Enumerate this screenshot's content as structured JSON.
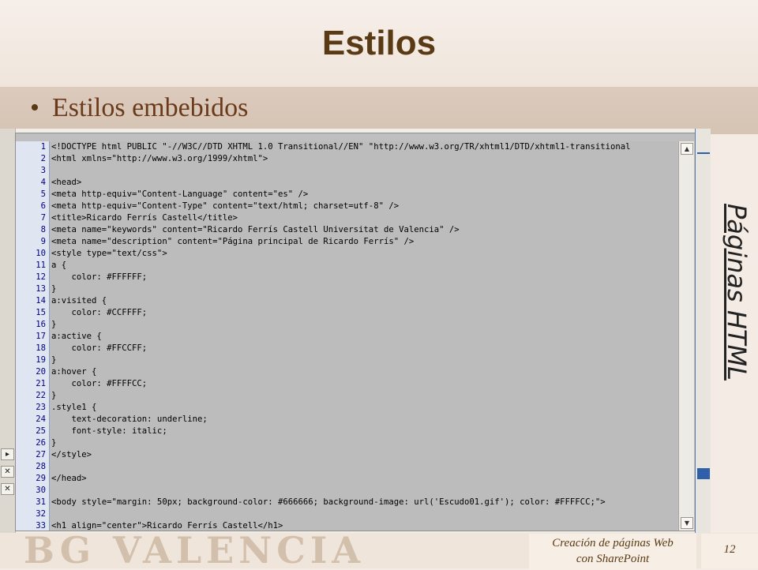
{
  "slide": {
    "title": "Estilos",
    "bullet": "Estilos embebidos",
    "side_title": "Páginas HTML",
    "footer_line1": "Creación de páginas Web",
    "footer_line2": "con SharePoint",
    "page_number": "12",
    "footer_logo_text": "BG VALENCIA"
  },
  "editor": {
    "line_numbers": [
      "1",
      "2",
      "3",
      "4",
      "5",
      "6",
      "7",
      "8",
      "9",
      "10",
      "11",
      "12",
      "13",
      "14",
      "15",
      "16",
      "17",
      "18",
      "19",
      "20",
      "21",
      "22",
      "23",
      "24",
      "25",
      "26",
      "27",
      "28",
      "29",
      "30",
      "31",
      "32",
      "33"
    ],
    "lines": [
      "<!DOCTYPE html PUBLIC \"-//W3C//DTD XHTML 1.0 Transitional//EN\" \"http://www.w3.org/TR/xhtml1/DTD/xhtml1-transitional",
      "<html xmlns=\"http://www.w3.org/1999/xhtml\">",
      "",
      "<head>",
      "<meta http-equiv=\"Content-Language\" content=\"es\" />",
      "<meta http-equiv=\"Content-Type\" content=\"text/html; charset=utf-8\" />",
      "<title>Ricardo Ferrís Castell</title>",
      "<meta name=\"keywords\" content=\"Ricardo Ferrís Castell Universitat de Valencia\" />",
      "<meta name=\"description\" content=\"Página principal de Ricardo Ferrís\" />",
      "<style type=\"text/css\">",
      "a {",
      "    color: #FFFFFF;",
      "}",
      "a:visited {",
      "    color: #CCFFFF;",
      "}",
      "a:active {",
      "    color: #FFCCFF;",
      "}",
      "a:hover {",
      "    color: #FFFFCC;",
      "}",
      ".style1 {",
      "    text-decoration: underline;",
      "    font-style: italic;",
      "}",
      "</style>",
      "",
      "</head>",
      "",
      "<body style=\"margin: 50px; background-color: #666666; background-image: url('Escudo01.gif'); color: #FFFFCC;\">",
      "",
      "<h1 align=\"center\">Ricardo Ferrís Castell</h1>"
    ]
  },
  "colors": {
    "title": "#5a3a14",
    "editor_bg": "#bcbcbc",
    "gutter_bg": "#dfe6f2",
    "tag": "#000080",
    "attr": "#8b1010"
  },
  "icons": {
    "scroll_up": "triangle-up-icon",
    "scroll_down": "triangle-down-icon",
    "close": "close-icon",
    "expand": "triangle-right-icon"
  }
}
